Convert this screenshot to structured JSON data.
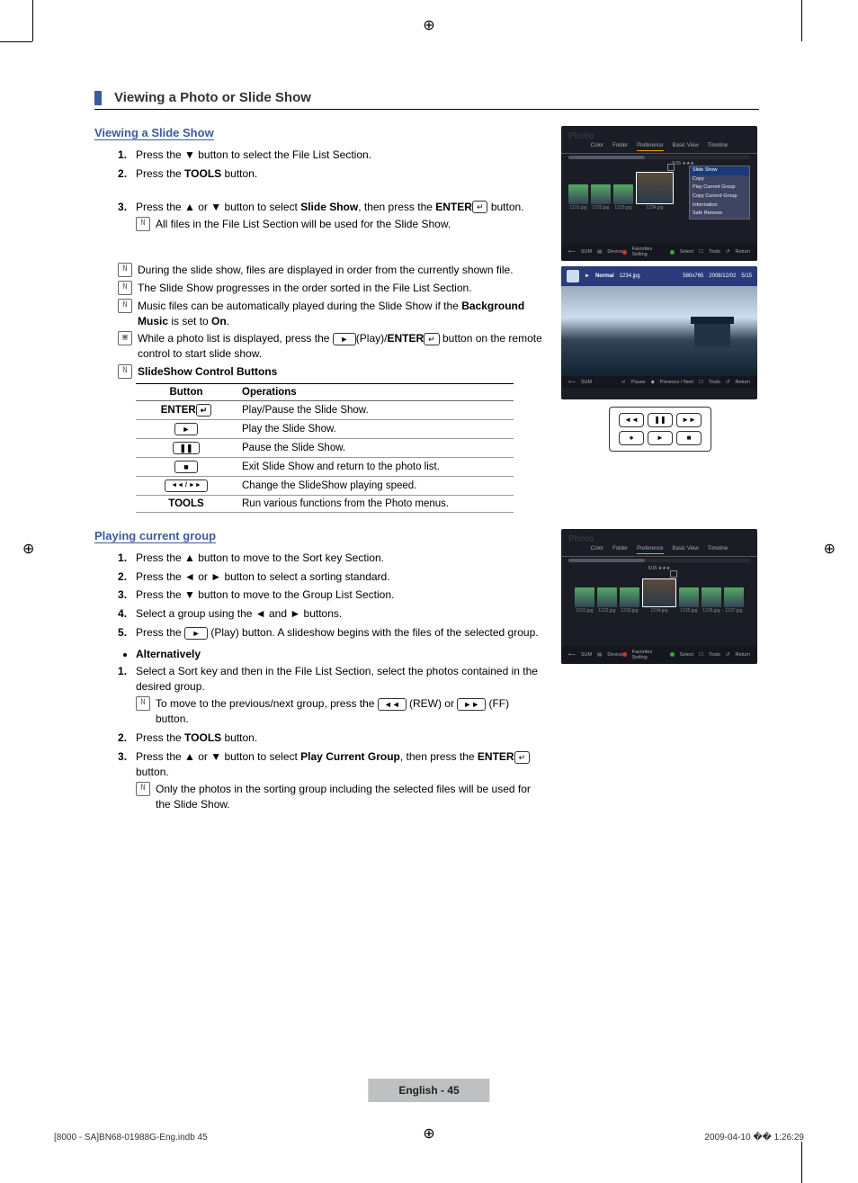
{
  "page_title": "Viewing a Photo or Slide Show",
  "section_a": {
    "title": "Viewing a Slide Show",
    "steps": [
      {
        "pre": "Press the ",
        "mid": "▼",
        "post": " button to select the File List Section."
      },
      {
        "pre": "Press the ",
        "bold": "TOOLS",
        "post": " button."
      },
      {
        "pre": "Press the ",
        "mid": "▲ or ▼",
        "post": " button to select ",
        "bold": "Slide Show",
        "post2": ", then press the ",
        "bold2": "ENTER",
        "post3": " button."
      }
    ],
    "step3_subnote": "All files in the File List Section will be used for the Slide Show.",
    "notes": [
      "During the slide show, files are displayed in order from the currently shown file.",
      "The Slide Show progresses in the order sorted in the File List Section."
    ],
    "music_note_pre": "Music files can be automatically played during the Slide Show if the ",
    "music_note_bold": "Background Music",
    "music_note_mid": " is set to ",
    "music_note_bold2": "On",
    "music_note_post": ".",
    "play_note_pre": "While a photo list is displayed, press the ",
    "play_note_mid": "(Play)/",
    "play_note_bold": "ENTER",
    "play_note_post": " button on the remote control to start slide show.",
    "table_title": "SlideShow Control Buttons",
    "table": {
      "headers": [
        "Button",
        "Operations"
      ],
      "rows": [
        {
          "btn_label": "ENTER",
          "btn_glyph": "↵",
          "op": "Play/Pause the Slide Show."
        },
        {
          "btn_glyph": "►",
          "op": "Play the Slide Show."
        },
        {
          "btn_glyph": "❚❚",
          "op": "Pause the Slide Show."
        },
        {
          "btn_glyph": "■",
          "op": "Exit Slide Show and return to the photo list."
        },
        {
          "btn_glyph": "◄◄ / ►►",
          "op": "Change the SlideShow playing speed."
        },
        {
          "btn_label": "TOOLS",
          "op": "Run various functions from the Photo menus."
        }
      ]
    }
  },
  "section_b": {
    "title": "Playing current group",
    "steps": [
      "Press the ▲ button to move to the Sort key Section.",
      "Press the ◄ or ► button to select a sorting standard.",
      "Press the ▼ button to move to the Group List Section.",
      "Select a group using the ◄ and ► buttons."
    ],
    "step5_pre": "Press the ",
    "step5_post": " (Play) button. A slideshow begins with the files of the selected group.",
    "alt_label": "Alternatively",
    "alt_steps": {
      "s1": "Select a Sort key and then in the File List Section, select the photos contained in the desired group.",
      "s1_note_pre": "To move to the previous/next group, press the ",
      "s1_note_rew": "(REW) or ",
      "s1_note_ff": "(FF) button.",
      "s2_pre": "Press the ",
      "s2_bold": "TOOLS",
      "s2_post": " button.",
      "s3_pre": "Press the ▲ or ▼ button to select ",
      "s3_bold": "Play Current Group",
      "s3_mid": ", then press the ",
      "s3_bold2": "ENTER",
      "s3_post": " button.",
      "s3_note": "Only the photos in the sorting group including the selected files will be used for the Slide Show."
    }
  },
  "screenshots": {
    "ss1": {
      "title": "Photo",
      "tabs": [
        "Color",
        "Folder",
        "Preference",
        "Basic View",
        "Timeline"
      ],
      "thumbs": [
        "1231.jpg",
        "1232.jpg",
        "1233.jpg",
        "1234.jpg"
      ],
      "counter": "5/15",
      "menu_header": "Slide Show",
      "menu_items": [
        "Copy",
        "Play Current Group",
        "Copy Current Group",
        "Information",
        "Safe Remove"
      ],
      "footer_left": [
        "SUM",
        "Device"
      ],
      "footer_right": [
        "Favorites Setting",
        "Select",
        "Tools",
        "Return"
      ]
    },
    "ss2": {
      "status": "Normal",
      "file": "1234.jpg",
      "res": "580x765",
      "date": "2008/12/02",
      "count": "5/15",
      "footer_left": "SUM",
      "footer_right": [
        "Pause",
        "Previous / Next",
        "Tools",
        "Return"
      ]
    },
    "remote": [
      "◄◄",
      "❚❚",
      "►►",
      "●",
      "►",
      "■"
    ],
    "ss3": {
      "title": "Photo",
      "tabs": [
        "Color",
        "Folder",
        "Preference",
        "Basic View",
        "Timeline"
      ],
      "counter": "5/15",
      "thumbs": [
        "1231.jpg",
        "1232.jpg",
        "1233.jpg",
        "1234.jpg",
        "1235.jpg",
        "1236.jpg",
        "1237.jpg"
      ],
      "footer_left": [
        "SUM",
        "Device"
      ],
      "footer_right": [
        "Favorites Setting",
        "Select",
        "Tools",
        "Return"
      ]
    }
  },
  "page_footer": "English - 45",
  "doc_footer_left": "[8000 - SA]BN68-01988G-Eng.indb   45",
  "doc_footer_right": "2009-04-10   �� 1:26:29"
}
